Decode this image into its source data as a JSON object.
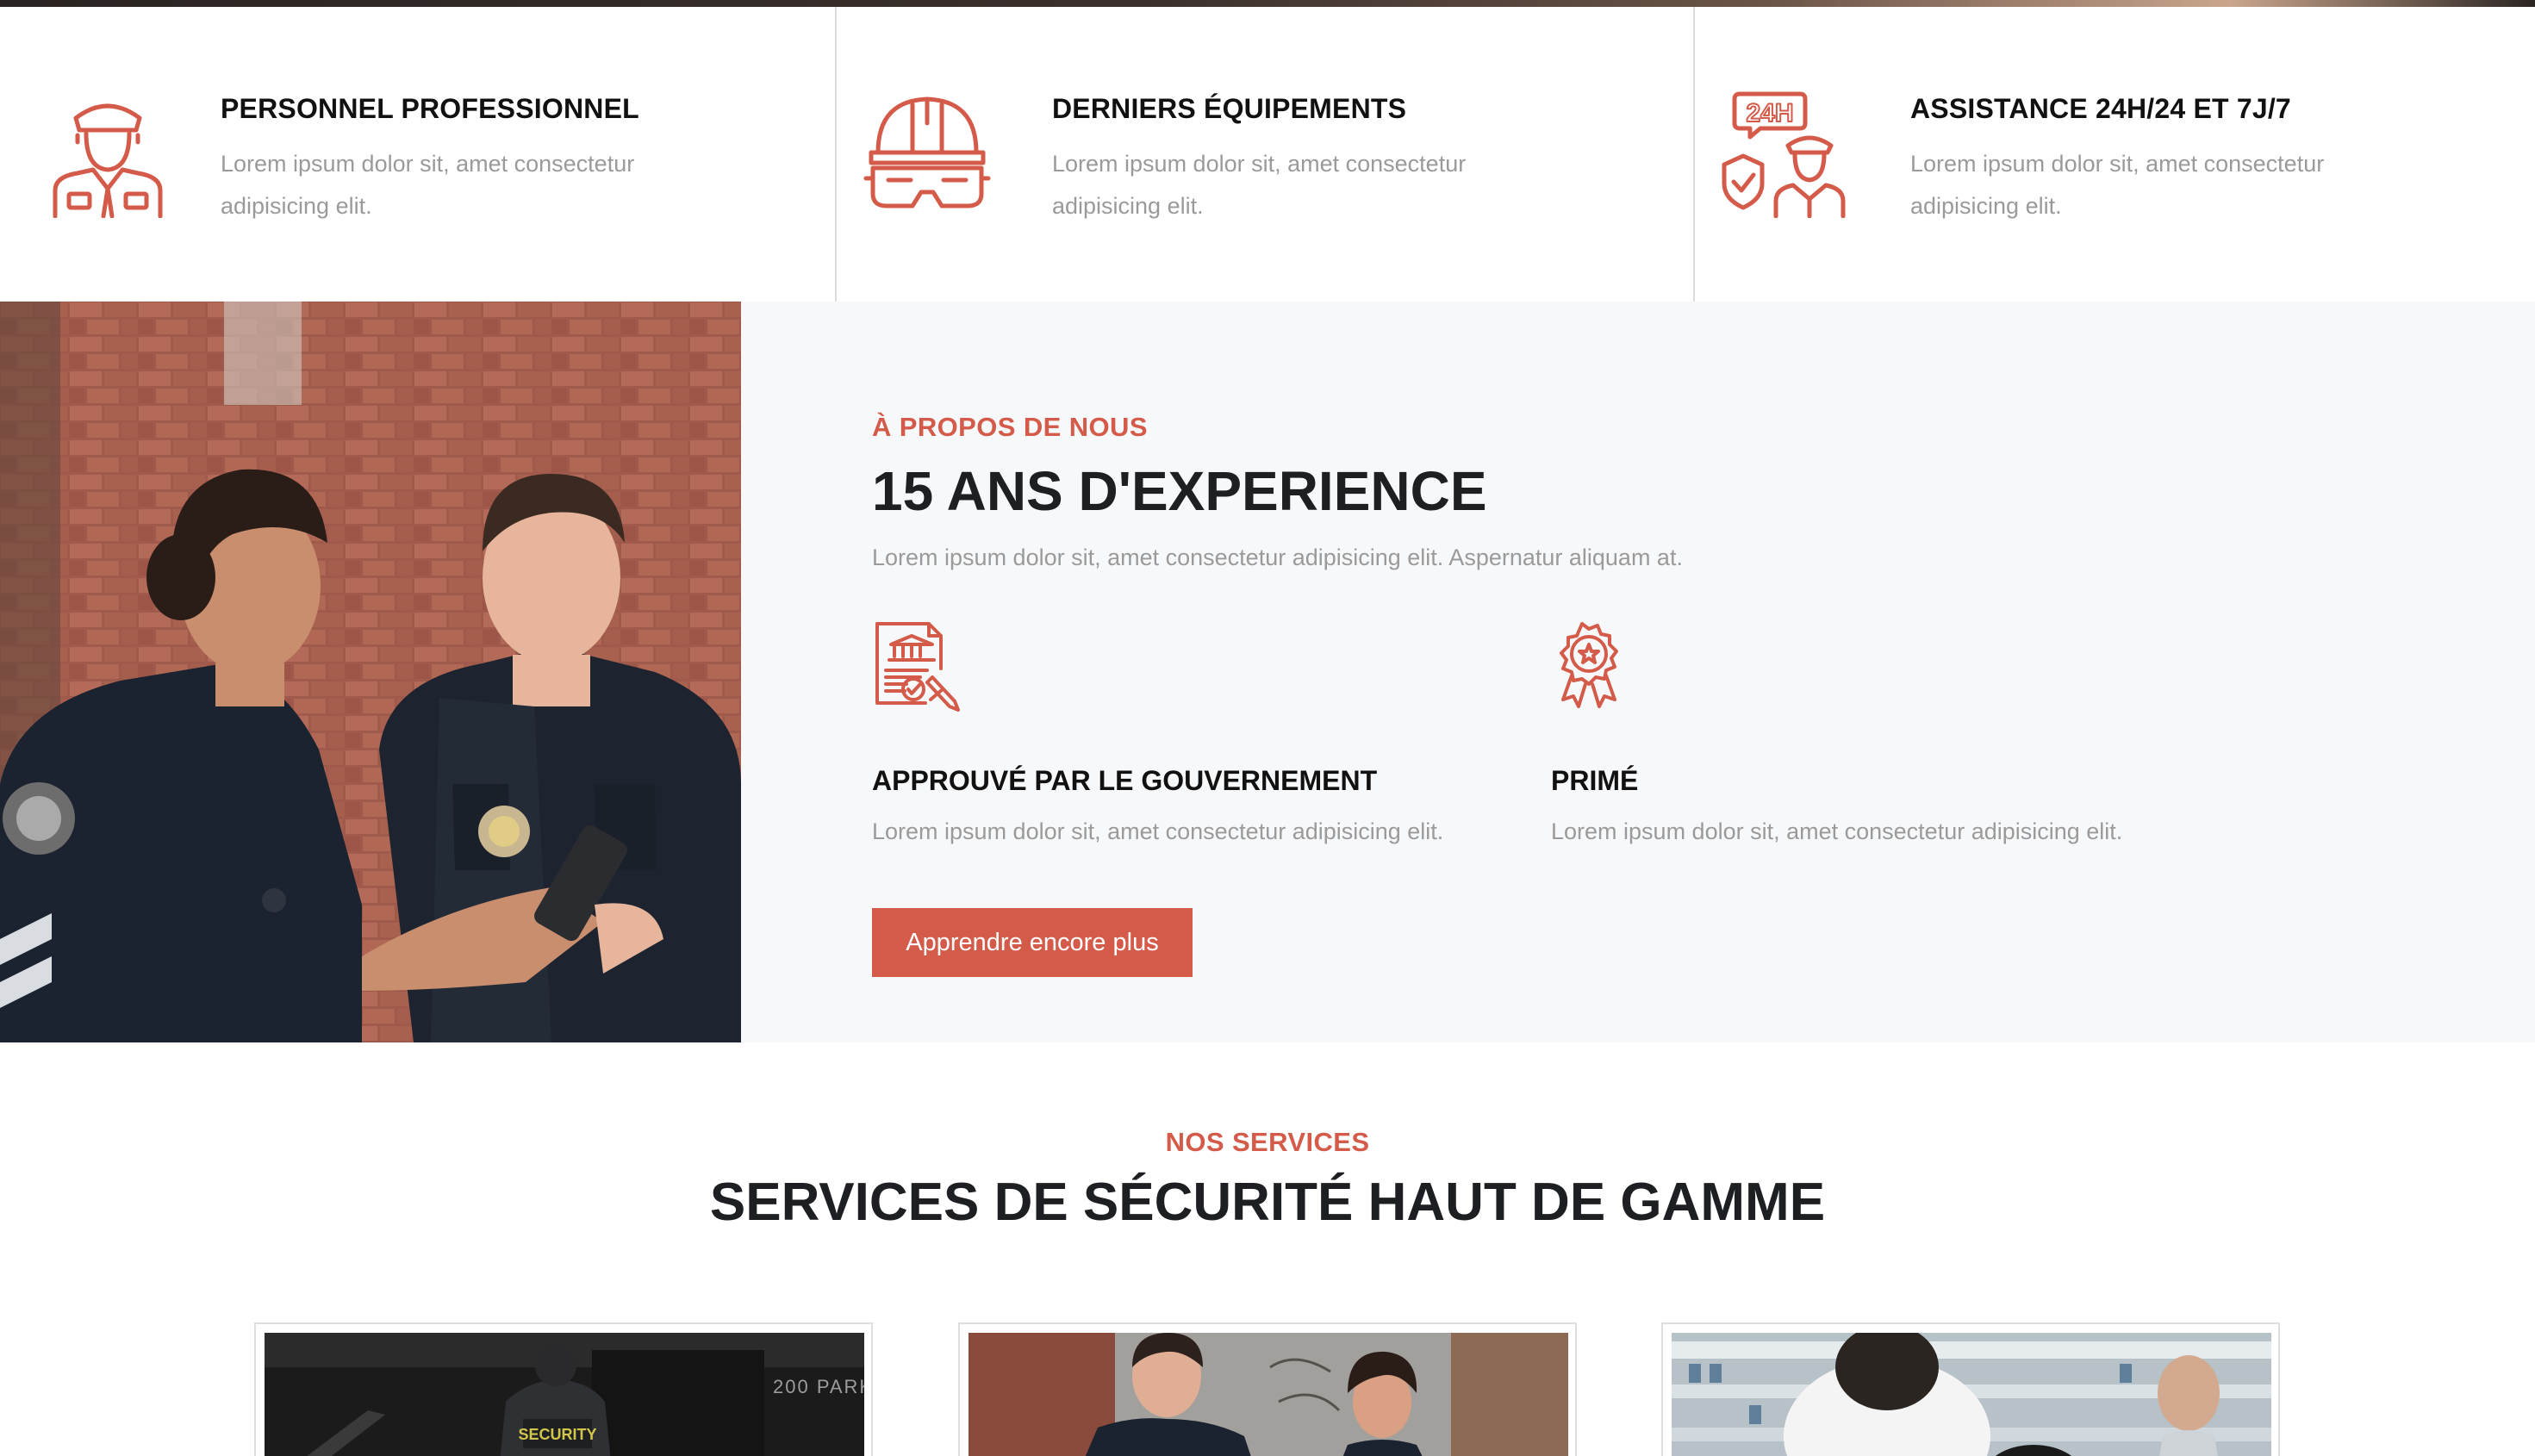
{
  "features": [
    {
      "title": "PERSONNEL PROFESSIONNEL",
      "text_line1": "Lorem ipsum dolor sit, amet consectetur",
      "text_line2": "adipisicing elit.",
      "icon": "security-guard-icon"
    },
    {
      "title": "DERNIERS ÉQUIPEMENTS",
      "text_line1": "Lorem ipsum dolor sit, amet consectetur",
      "text_line2": "adipisicing elit.",
      "icon": "helmet-goggles-icon"
    },
    {
      "title": "ASSISTANCE 24H/24 ET 7J/7",
      "text_line1": "Lorem ipsum dolor sit, amet consectetur",
      "text_line2": "adipisicing elit.",
      "icon": "support-24h-icon",
      "badge": "24H"
    }
  ],
  "about": {
    "eyebrow": "À PROPOS DE NOUS",
    "title": "15 ANS D'EXPERIENCE",
    "text": "Lorem ipsum dolor sit, amet consectetur adipisicing elit. Aspernatur aliquam at.",
    "points": [
      {
        "title": "APPROUVÉ PAR LE GOUVERNEMENT",
        "text": "Lorem ipsum dolor sit, amet consectetur adipisicing elit.",
        "icon": "certificate-icon"
      },
      {
        "title": "PRIMÉ",
        "text": "Lorem ipsum dolor sit, amet consectetur adipisicing elit.",
        "icon": "award-icon"
      }
    ],
    "cta_label": "Apprendre encore plus"
  },
  "services": {
    "eyebrow": "NOS SERVICES",
    "title": "SERVICES DE SÉCURITÉ HAUT DE GAMME",
    "card1_text": "200 PARK",
    "card1_badge": "SECURITY"
  },
  "colors": {
    "accent": "#d45b49",
    "muted_text": "#9a9a9a",
    "heading": "#1e1f22",
    "section_bg": "#f7f8fa"
  }
}
